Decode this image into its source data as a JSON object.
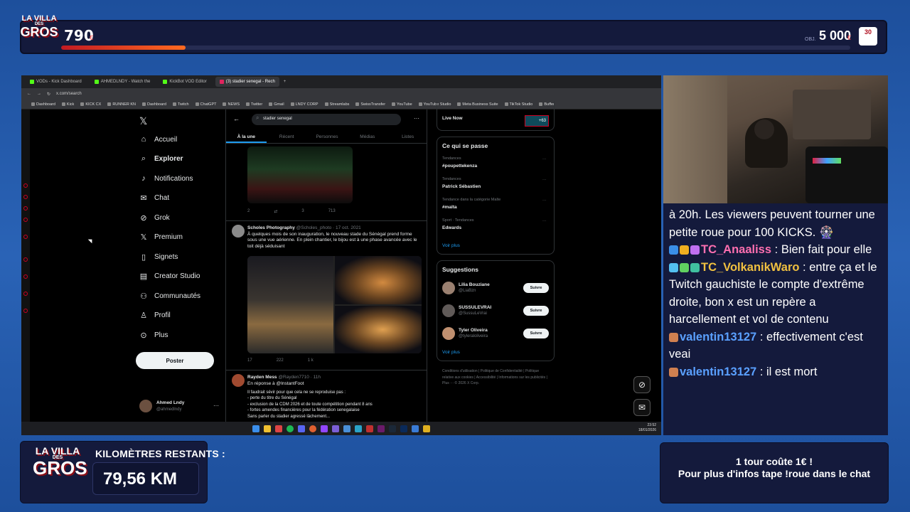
{
  "top_bar": {
    "logo": {
      "line1": "LA VILLA",
      "line2": "DES",
      "line3": "GROS"
    },
    "goal_current": "790",
    "goal_current_unit": "€",
    "goal_small_label": "OBJ.",
    "goal_target": "5 000",
    "goal_target_unit": "€",
    "goal_progress_fraction": 0.158,
    "badge_text": "30"
  },
  "browser": {
    "tabs": [
      {
        "label": "VODs - Kick Dashboard",
        "active": false
      },
      {
        "label": "AHMEDLNDY - Watch the",
        "active": false
      },
      {
        "label": "KickBot VOD Editor",
        "active": false
      },
      {
        "label": "(3) stadier senegal - Rech",
        "active": true
      }
    ],
    "url": "x.com/search",
    "bookmarks": [
      "Dashboard",
      "Kick",
      "KICK CX",
      "RUNNER KN",
      "Dashboard",
      "Twitch",
      "ChatGPT",
      "NEWS",
      "Twitter",
      "Gmail",
      "LNDY CORP",
      "Streamlabs",
      "SwissTransfer",
      "YouTube",
      "YouTube Studio",
      "Meta Business Suite",
      "TikTok Studio",
      "Buffer"
    ]
  },
  "x_nav": {
    "logo": "𝕏",
    "items": [
      {
        "label": "Accueil",
        "icon": "home-icon",
        "glyph": "⌂"
      },
      {
        "label": "Explorer",
        "icon": "search-icon",
        "glyph": "⌕"
      },
      {
        "label": "Notifications",
        "icon": "bell-icon",
        "glyph": "♪"
      },
      {
        "label": "Chat",
        "icon": "mail-icon",
        "glyph": "✉"
      },
      {
        "label": "Grok",
        "icon": "grok-icon",
        "glyph": "⊘"
      },
      {
        "label": "Premium",
        "icon": "x-icon",
        "glyph": "𝕏"
      },
      {
        "label": "Signets",
        "icon": "bookmark-icon",
        "glyph": "▯"
      },
      {
        "label": "Creator Studio",
        "icon": "chart-icon",
        "glyph": "▤"
      },
      {
        "label": "Communautés",
        "icon": "people-icon",
        "glyph": "⚇"
      },
      {
        "label": "Profil",
        "icon": "person-icon",
        "glyph": "♙"
      },
      {
        "label": "Plus",
        "icon": "more-icon",
        "glyph": "⊙"
      }
    ],
    "post_button": "Poster",
    "profile": {
      "name": "Ahmed Lndy",
      "handle": "@ahmedlndy"
    }
  },
  "feed": {
    "search_value": "stadier senegal",
    "filter_tabs": [
      {
        "label": "À la une",
        "active": true
      },
      {
        "label": "Récent",
        "active": false
      },
      {
        "label": "Personnes",
        "active": false
      },
      {
        "label": "Médias",
        "active": false
      },
      {
        "label": "Listes",
        "active": false
      }
    ],
    "first_tweet_stats": {
      "replies": "2",
      "likes": "3",
      "views": "713"
    },
    "tweet2": {
      "name": "Scholes Photography",
      "handle_date": "@Scholes_photo · 17 oct. 2021",
      "text": "À quelques mois de son inauguration, le nouveau stade du Sénégal prend forme sous une vue aérienne. En plein chantier, le bijou est à une phase avancée avec le toit déjà séduisant",
      "replies": "17",
      "reposts": "222",
      "likes": "1 k"
    },
    "tweet3": {
      "name": "Rayden Mess",
      "handle_date": "@Rayden7710 · 11h",
      "reply_to": "En réponse à @InstantFoot",
      "lines": [
        "Il faudrait sévir pour que cela ne se reproduise pas :",
        "- perte du titre du Sénégal",
        "- exclusion de la CDM 2026 et de toute compétition pendant 8 ans",
        "- fortes amendes financières pour la fédération senegalaise",
        "Sans parler du stadier agressé lâchement..."
      ]
    }
  },
  "right_col": {
    "live": {
      "label": "Live Now",
      "count": "+63"
    },
    "trends_title": "Ce qui se passe",
    "trends": [
      {
        "category": "Tendances",
        "name": "#poupettekenza"
      },
      {
        "category": "Tendances",
        "name": "Patrick Sébastien"
      },
      {
        "category": "Tendance dans la catégorie Malte",
        "name": "#malta"
      },
      {
        "category": "Sport · Tendances",
        "name": "Edwards"
      }
    ],
    "see_more": "Voir plus",
    "suggestions_title": "Suggestions",
    "suggestions": [
      {
        "name": "Lilia Bouziane",
        "handle": "@LiaBzn",
        "button": "Suivre"
      },
      {
        "name": "SUSSULEVRAI",
        "handle": "@SussuLeVrai",
        "button": "Suivre"
      },
      {
        "name": "Tyler Oliveira",
        "handle": "@tyleraloliveira",
        "button": "Suivre"
      }
    ],
    "footer": "Conditions d'utilisation | Politique de Confidentialité | Politique relative aux cookies | Accessibilité | Informations sur les publicités | Plus ··· © 2026 X Corp."
  },
  "taskbar": {
    "time": "23:52",
    "date": "18/01/2026"
  },
  "chat": {
    "messages": [
      {
        "user": "",
        "user_color": "#ffffff",
        "badges": [],
        "text": "à 20h. Les viewers peuvent tourner une petite roue pour 100 KICKS. 🎡"
      },
      {
        "user": "TC_Anaaliss",
        "user_color": "#ff6fb0",
        "badges": [
          "#3a8fe8",
          "#f0b020",
          "#c070f0"
        ],
        "text": "Bien fait pour elle"
      },
      {
        "user": "TC_VolkanikWaro",
        "user_color": "#f0c040",
        "badges": [
          "#53c0f0",
          "#60d060",
          "#40c0a0"
        ],
        "text": "entre ça et le Twitch gauchiste le compte d'extrême droite, bon x est un repère a harcellement et vol de contenu"
      },
      {
        "user": "valentin13127",
        "user_color": "#5aa0ff",
        "badges": [
          "#d08050"
        ],
        "text": "effectivement c'est veai"
      },
      {
        "user": "valentin13127",
        "user_color": "#5aa0ff",
        "badges": [
          "#d08050"
        ],
        "text": "il est mort"
      }
    ]
  },
  "km": {
    "label": "KILOMÈTRES RESTANTS :",
    "value": "79,56 KM"
  },
  "roue": {
    "line1": "1 tour coûte 1€ !",
    "line2": "Pour plus d'infos tape !roue dans le chat"
  }
}
